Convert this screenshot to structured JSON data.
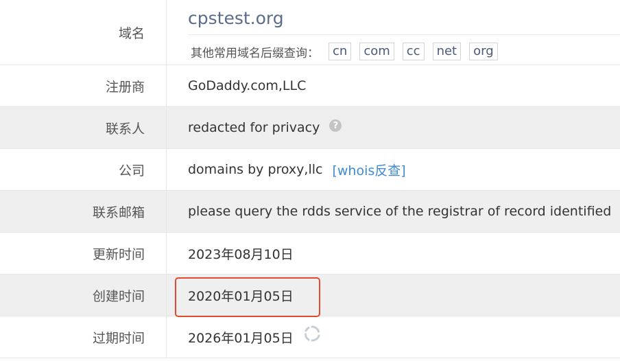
{
  "domain": {
    "label": "域名",
    "value": "cpstest.org",
    "suffix_label": "其他常用域名后缀查询：",
    "suffixes": [
      "cn",
      "com",
      "cc",
      "net",
      "org"
    ]
  },
  "rows": [
    {
      "label": "注册商",
      "value": "GoDaddy.com,LLC"
    },
    {
      "label": "联系人",
      "value": "redacted for privacy",
      "icon": "help-icon"
    },
    {
      "label": "公司",
      "value": "domains by proxy,llc",
      "link": "[whois反查]"
    },
    {
      "label": "联系邮箱",
      "value": "please query the rdds service of the registrar of record identified"
    },
    {
      "label": "更新时间",
      "value": "2023年08月10日"
    },
    {
      "label": "创建时间",
      "value": "2020年01月05日"
    },
    {
      "label": "过期时间",
      "value": "2026年01月05日",
      "icon": "refresh-icon"
    }
  ],
  "colors": {
    "highlight": "#e04a2f",
    "link": "#3e8ad8",
    "title": "#5b6b8a"
  }
}
